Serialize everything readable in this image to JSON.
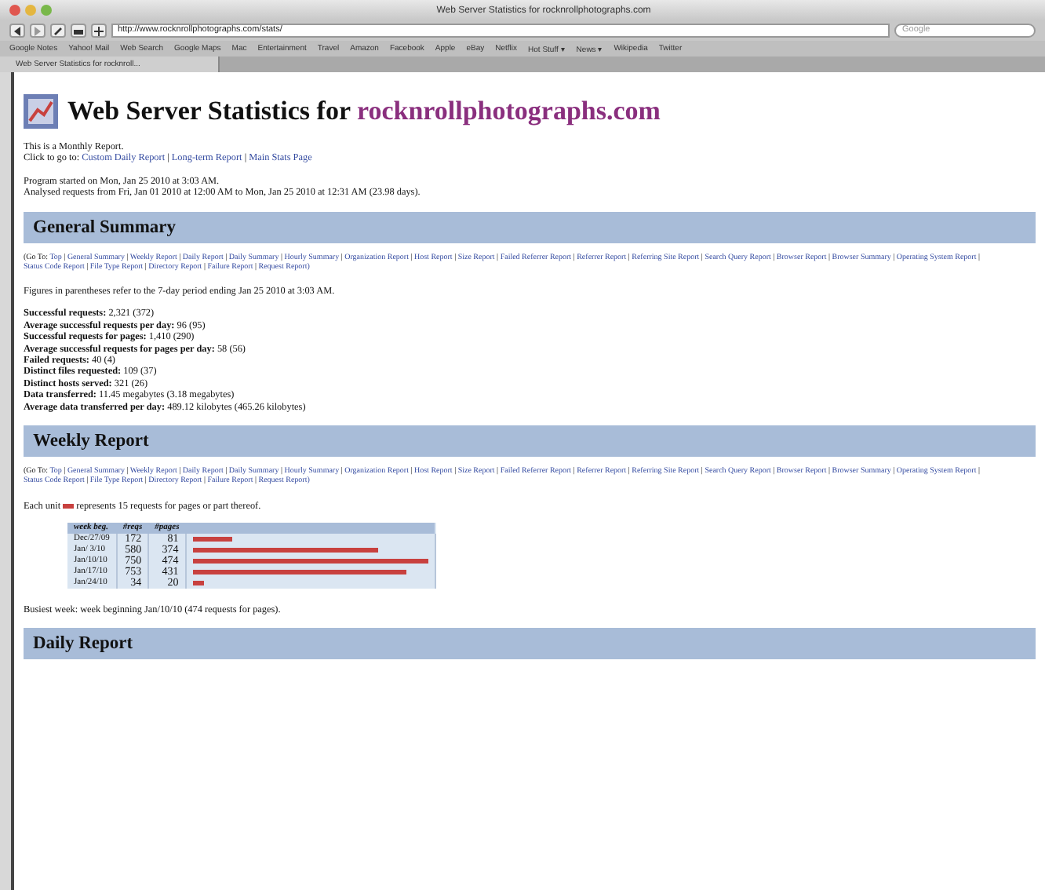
{
  "window": {
    "title": "Web Server Statistics for rocknrollphotographs.com"
  },
  "toolbar": {
    "address": "http://www.rocknrollphotographs.com/stats/",
    "search_placeholder": "Google"
  },
  "bookmarks": [
    "Google Notes",
    "Yahoo! Mail",
    "Web Search",
    "Google Maps",
    "Mac",
    "Entertainment",
    "Travel",
    "Amazon",
    "Facebook",
    "Apple",
    "eBay",
    "Netflix",
    "Hot Stuff ▾",
    "News ▾",
    "Wikipedia",
    "Twitter"
  ],
  "tabs": [
    {
      "label": "Web Server Statistics for rocknroll...",
      "selected": true
    }
  ],
  "page": {
    "title": "Web Server Statistics for ",
    "site": "rocknrollphotographs.com",
    "intro": "This is a Monthly Report.",
    "goto_label": "Click to go to:",
    "goto_links": [
      "Custom Daily Report",
      "Long-term Report",
      "Main Stats Page"
    ],
    "separator": "|",
    "started": "Program started on Mon, Jan 25 2010 at 3:03 AM.",
    "analysed": "Analysed requests from Fri, Jan 01 2010 at 12:00 AM to Mon, Jan 25 2010 at 12:31 AM (23.98 days).",
    "sections": [
      {
        "kind": "summary",
        "heading": "General Summary",
        "nav_label": "(Go To:",
        "nav_links": [
          "Top",
          "General Summary",
          "Weekly Report",
          "Daily Report",
          "Daily Summary",
          "Hourly Summary",
          "Organization Report",
          "Host Report",
          "Size Report",
          "Failed Referrer Report",
          "Referrer Report",
          "Referring Site Report",
          "Search Query Report",
          "Browser Report",
          "Browser Summary",
          "Operating System Report",
          "Status Code Report",
          "File Type Report",
          "Directory Report",
          "Failure Report",
          "Request Report)"
        ],
        "note": "Figures in parentheses refer to the 7-day period ending Jan 25 2010 at 3:03 AM.",
        "lines": [
          "**Successful requests:** 2,321 (372)",
          "**Average successful requests per day:** 96 (95)",
          "**Successful requests for pages:** 1,410 (290)",
          "**Average successful requests for pages per day:** 58 (56)",
          "**Failed requests:** 40 (4)",
          "**Distinct files requested:** 109 (37)",
          "**Distinct hosts served:** 321 (26)",
          "**Data transferred:** 11.45 megabytes (3.18 megabytes)",
          "**Average data transferred per day:** 489.12 kilobytes (465.26 kilobytes)"
        ]
      },
      {
        "kind": "weekly",
        "heading": "Weekly Report",
        "nav_label": "(Go To:",
        "nav_links": [
          "Top",
          "General Summary",
          "Weekly Report",
          "Daily Report",
          "Daily Summary",
          "Hourly Summary",
          "Organization Report",
          "Host Report",
          "Size Report",
          "Failed Referrer Report",
          "Referrer Report",
          "Referring Site Report",
          "Search Query Report",
          "Browser Report",
          "Browser Summary",
          "Operating System Report",
          "Status Code Report",
          "File Type Report",
          "Directory Report",
          "Failure Report",
          "Request Report)"
        ],
        "unit_before": "Each unit",
        "unit_after": "represents 15 requests for pages or part thereof.",
        "columns": [
          "week beg.",
          "#reqs",
          "#pages"
        ],
        "rows": [
          {
            "week": "Dec/27/09",
            "reqs": "172",
            "pages": "81",
            "level": 0.17
          },
          {
            "week": "Jan/ 3/10",
            "reqs": "580",
            "pages": "374",
            "level": 0.79
          },
          {
            "week": "Jan/10/10",
            "reqs": "750",
            "pages": "474",
            "level": 1.0
          },
          {
            "week": "Jan/17/10",
            "reqs": "753",
            "pages": "431",
            "level": 0.91
          },
          {
            "week": "Jan/24/10",
            "reqs": "34",
            "pages": "20",
            "level": 0.05
          }
        ],
        "busiest": "Busiest week: week beginning Jan/10/10 (474 requests for pages)."
      },
      {
        "kind": "heading_only",
        "heading": "Daily Report"
      }
    ]
  }
}
